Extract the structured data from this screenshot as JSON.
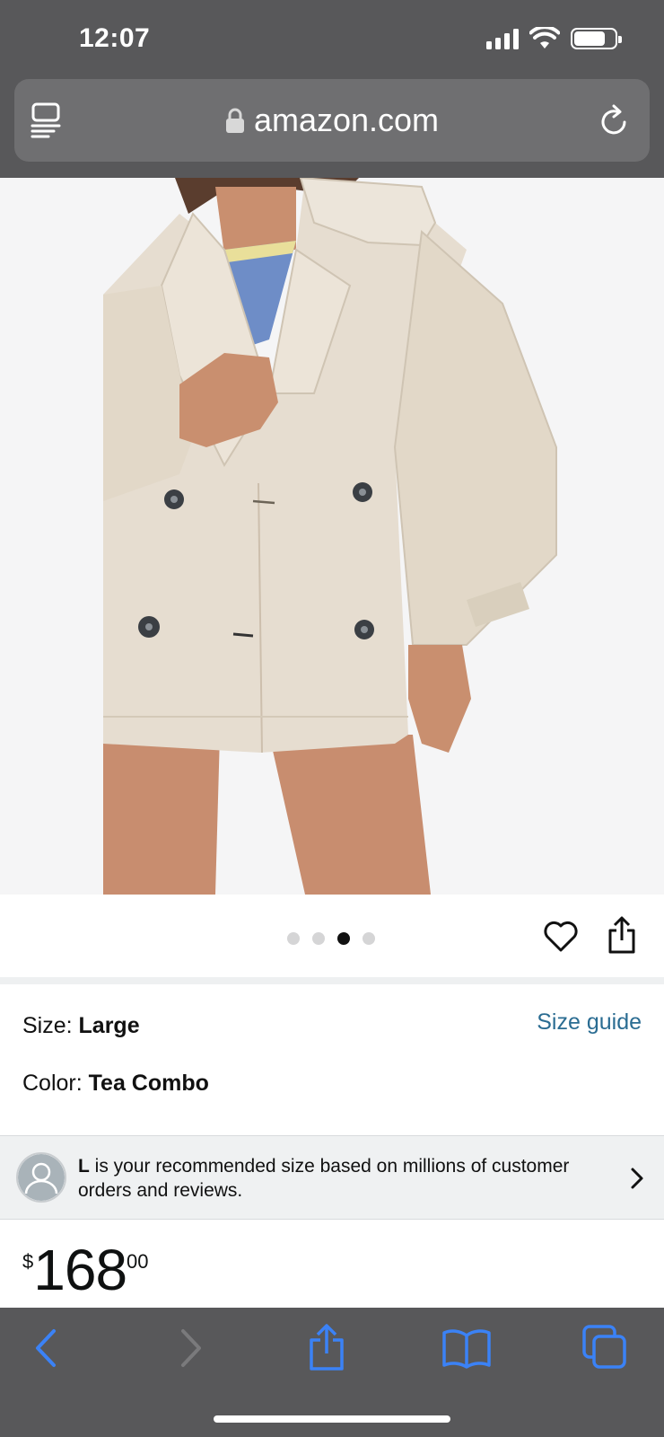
{
  "status_bar": {
    "time": "12:07"
  },
  "browser": {
    "url": "amazon.com"
  },
  "carousel": {
    "dot_count": 4,
    "active_index": 2
  },
  "variations": {
    "size_label": "Size: ",
    "size_value": "Large",
    "size_guide_link": "Size guide",
    "color_label": "Color: ",
    "color_value": "Tea Combo"
  },
  "recommendation": {
    "size": "L",
    "text": " is your recommended size based on millions of customer orders and reviews."
  },
  "price": {
    "currency_symbol": "$",
    "whole": "168",
    "fraction": "00"
  },
  "colors": {
    "safari_chrome": "#58585a",
    "link": "#2a6c92",
    "toolbar_icon": "#3b82f6"
  },
  "icons": [
    "reader-icon",
    "lock-icon",
    "reload-icon",
    "heart-icon",
    "share-icon",
    "chevron-right-icon",
    "back-icon",
    "forward-icon",
    "bookmarks-icon",
    "tabs-icon"
  ]
}
